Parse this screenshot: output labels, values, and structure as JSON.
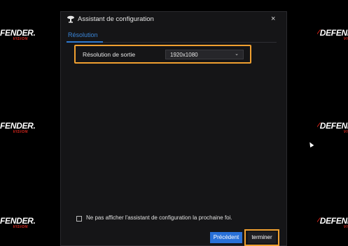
{
  "background_logo": {
    "brand": "DEFENDER",
    "left_text": "FENDER.",
    "right_text": "DEFEND",
    "sub": "VISION",
    "left_sub": "VISION",
    "right_sub": "VI"
  },
  "dialog": {
    "title": "Assistant de configuration",
    "close_glyph": "×",
    "tab_label": "Résolution",
    "output_resolution_label": "Résolution de sortie",
    "output_resolution_value": "1920x1080",
    "chevron_glyph": "⌄",
    "hide_wizard_label": "Ne pas afficher l'assistant de configuration la prochaine foi.",
    "previous_button": "Précédent",
    "finish_button": "terminer"
  },
  "colors": {
    "accent_blue": "#2870d8",
    "highlight_orange": "#f0a030",
    "brand_red": "#d9261c"
  }
}
